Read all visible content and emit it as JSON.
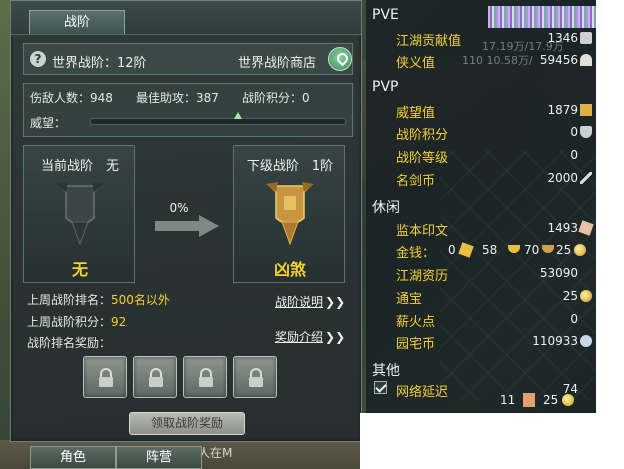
{
  "panel": {
    "tab_label": "战阶",
    "current_rank_label": "世界战阶：12阶",
    "shop_label": "世界战阶商店",
    "stats": {
      "kills": "伤敌人数：948",
      "best_assist": "最佳助攻：387",
      "points": "战阶积分：0"
    },
    "prestige_label": "威望：",
    "prestige_progress": 0.58,
    "current_box": {
      "header": "当前战阶　无",
      "name": "无"
    },
    "next_box": {
      "header": "下级战阶　1阶",
      "name": "凶煞"
    },
    "progress_pct": "0%",
    "last_week_rank_label": "上周战阶排名：",
    "last_week_rank_value": "500名以外",
    "last_week_points_label": "上周战阶积分：",
    "last_week_points_value": "92",
    "reward_label": "战阶排名奖励：",
    "explain_link": "战阶说明",
    "reward_link": "奖励介绍",
    "claim_button": "领取战阶奖励",
    "chevron": "❯❯"
  },
  "bottom_tabs": [
    "角色",
    "阵营"
  ],
  "chat_snippet": "息有配对人在M",
  "stats_panel": {
    "sections": [
      {
        "title": "PVE",
        "rows": [
          {
            "label": "江湖贡献值",
            "value": "1346",
            "icon": "silver-ingot-icon"
          },
          {
            "label": "侠义值",
            "value": "59456",
            "icon": "fan-icon"
          }
        ]
      },
      {
        "title": "PVP",
        "rows": [
          {
            "label": "威望值",
            "value": "1879",
            "icon": "gold-token-icon"
          },
          {
            "label": "战阶积分",
            "value": "0",
            "icon": "shield-icon"
          },
          {
            "label": "战阶等级",
            "value": "0",
            "icon": ""
          },
          {
            "label": "名剑币",
            "value": "2000",
            "icon": "sword-icon"
          }
        ]
      },
      {
        "title": "休闲",
        "rows": [
          {
            "label": "监本印文",
            "value": "1493",
            "icon": "seal-icon"
          },
          {
            "label": "江湖资历",
            "value": "53090",
            "icon": ""
          },
          {
            "label": "通宝",
            "value": "25",
            "icon": "coin-icon"
          },
          {
            "label": "薪火点",
            "value": "0",
            "icon": ""
          },
          {
            "label": "园宅币",
            "value": "110933",
            "icon": "house-coin-icon"
          }
        ],
        "money": {
          "label": "金钱：",
          "gold": "0",
          "silver": "58",
          "copper": "70",
          "extra": "25"
        }
      },
      {
        "title": "其他",
        "rows": [
          {
            "label": "网络延迟",
            "value": "74",
            "icon": ""
          }
        ]
      }
    ],
    "ghost_text_1": "17.19万/17.9万",
    "ghost_text_2": "110  10.58万/",
    "bottom_counts": {
      "first": "11",
      "second": "25"
    }
  }
}
